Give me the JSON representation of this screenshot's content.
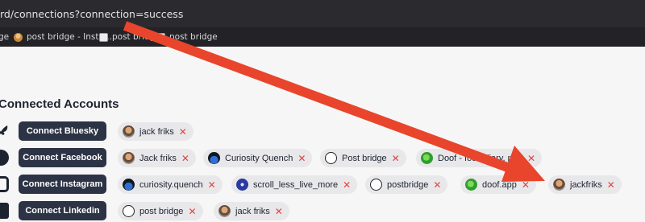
{
  "browser": {
    "url": "rd/connections?connection=success",
    "bookmarks": [
      {
        "label": "ge",
        "icon": "none"
      },
      {
        "label": "post bridge - Insta...",
        "icon": "person-icon"
      },
      {
        "label": "post bridge",
        "icon": "page-icon"
      },
      {
        "label": "post bridge",
        "icon": "page-icon"
      }
    ]
  },
  "page": {
    "title": "Connected Accounts",
    "rows": [
      {
        "network": "Bluesky",
        "button": "Connect Bluesky",
        "accounts": [
          {
            "name": "jack friks",
            "avatar": "face"
          }
        ]
      },
      {
        "network": "Facebook",
        "button": "Connect Facebook",
        "accounts": [
          {
            "name": "Jack friks",
            "avatar": "face"
          },
          {
            "name": "Curiosity Quench",
            "avatar": "cq"
          },
          {
            "name": "Post bridge",
            "avatar": "pb"
          },
          {
            "name": "Doof - food diary, pho",
            "avatar": "doof"
          }
        ]
      },
      {
        "network": "Instagram",
        "button": "Connect Instagram",
        "accounts": [
          {
            "name": "curiosity.quench",
            "avatar": "cq"
          },
          {
            "name": "scroll_less_live_more",
            "avatar": "scroll"
          },
          {
            "name": "postbridge",
            "avatar": "pb"
          },
          {
            "name": "doof.app",
            "avatar": "doof"
          },
          {
            "name": "jackfriks",
            "avatar": "face"
          }
        ]
      },
      {
        "network": "Linkedin",
        "button": "Connect Linkedin",
        "accounts": [
          {
            "name": "post bridge",
            "avatar": "pb"
          },
          {
            "name": "jack friks",
            "avatar": "face"
          }
        ]
      }
    ],
    "remove_symbol": "✕"
  },
  "colors": {
    "button_bg": "#2c3344",
    "remove_x": "#e0453b",
    "annotation_arrow": "#e8452c"
  }
}
